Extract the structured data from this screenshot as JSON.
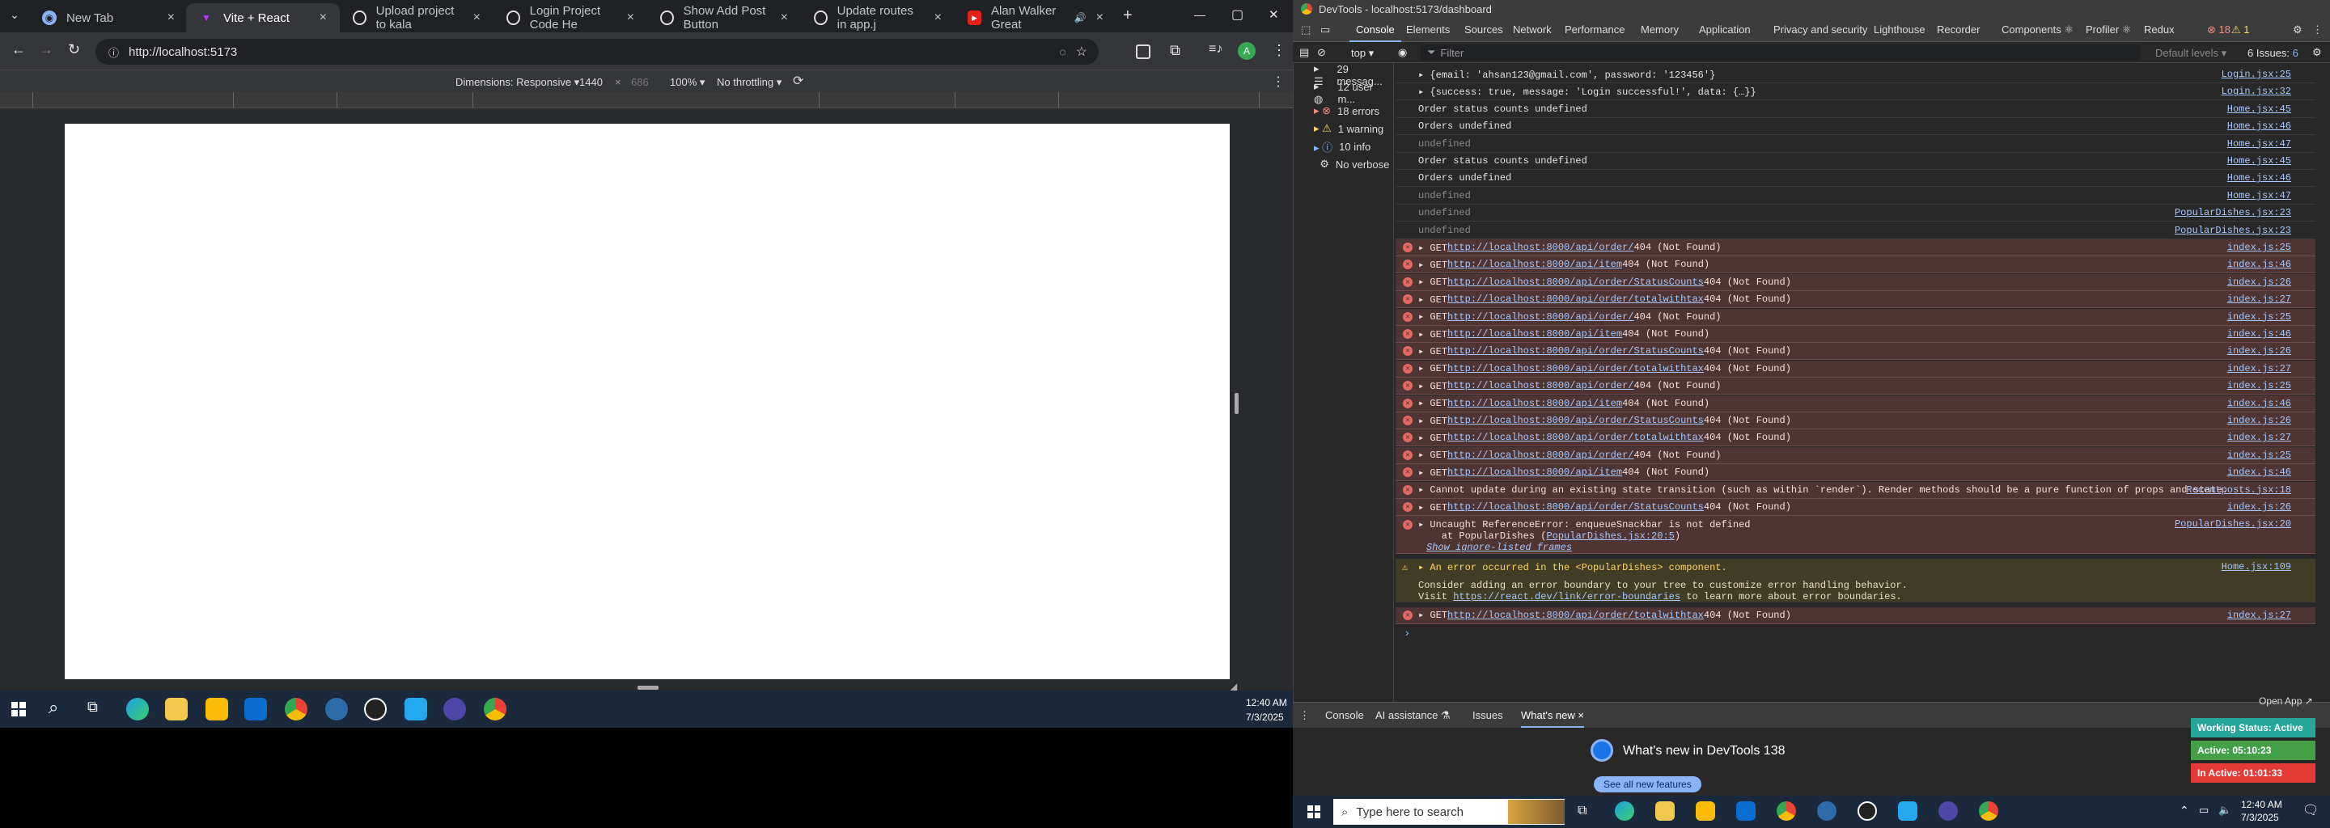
{
  "browser": {
    "tabs": [
      {
        "label": "New Tab",
        "close": "×"
      },
      {
        "label": "Vite + React",
        "close": "×"
      },
      {
        "label": "Upload project to kala",
        "close": "×"
      },
      {
        "label": "Login Project Code He",
        "close": "×"
      },
      {
        "label": "Show Add Post Button",
        "close": "×"
      },
      {
        "label": "Update routes in app.j",
        "close": "×"
      },
      {
        "label": "Alan Walker Great",
        "close": "×"
      }
    ],
    "new_tab": "+",
    "url": "http://localhost:5173",
    "window_controls": {
      "minimize": "—",
      "maximize": "▢",
      "close": "✕"
    }
  },
  "device_toolbar": {
    "dimensions_label": "Dimensions: Responsive ▾",
    "width": "1440",
    "times": "×",
    "height": "686",
    "zoom": "100% ▾",
    "throttling": "No throttling ▾"
  },
  "taskbar_left": {
    "time": "12:40 AM",
    "date": "7/3/2025"
  },
  "devtools": {
    "window_title": "DevTools - localhost:5173/dashboard",
    "tabs": [
      "Console",
      "Elements",
      "Sources",
      "Network",
      "Performance",
      "Memory",
      "Application",
      "Privacy and security",
      "Lighthouse",
      "Recorder",
      "Components ⚛",
      "Profiler ⚛",
      "Redux"
    ],
    "error_count": "18",
    "warning_count": "1",
    "issues_label": "6 Issues:",
    "issues_count": "6",
    "context": "top ▾",
    "filter_placeholder": "Filter",
    "levels": "Default levels ▾",
    "sidebar": [
      {
        "icon": "list",
        "label": "29 messag..."
      },
      {
        "icon": "user",
        "label": "12 user m..."
      },
      {
        "icon": "error",
        "label": "18 errors"
      },
      {
        "icon": "warning",
        "label": "1 warning"
      },
      {
        "icon": "info",
        "label": "10 info"
      },
      {
        "icon": "verbose",
        "label": "No verbose"
      }
    ],
    "console_rows": [
      {
        "type": "log",
        "text": "▸ {email: 'ahsan123@gmail.com', password: '123456'}",
        "src": "Login.jsx:25"
      },
      {
        "type": "log",
        "text": "▸ {success: true, message: 'Login successful!', data: {…}}",
        "src": "Login.jsx:32"
      },
      {
        "type": "log",
        "text": "Order status counts undefined",
        "src": "Home.jsx:45"
      },
      {
        "type": "log",
        "text": "Orders undefined",
        "src": "Home.jsx:46"
      },
      {
        "type": "log",
        "text": "undefined",
        "src": "Home.jsx:47"
      },
      {
        "type": "log",
        "text": "Order status counts undefined",
        "src": "Home.jsx:45"
      },
      {
        "type": "log",
        "text": "Orders undefined",
        "src": "Home.jsx:46"
      },
      {
        "type": "log",
        "text": "undefined",
        "src": "Home.jsx:47"
      },
      {
        "type": "log",
        "text": "undefined",
        "src": "PopularDishes.jsx:23"
      },
      {
        "type": "log",
        "text": "undefined",
        "src": "PopularDishes.jsx:23"
      },
      {
        "type": "err",
        "text": "▸ GET ",
        "url": "http://localhost:8000/api/order/",
        "tail": " 404 (Not Found)",
        "src": "index.js:25"
      },
      {
        "type": "err",
        "text": "▸ GET ",
        "url": "http://localhost:8000/api/item",
        "tail": " 404 (Not Found)",
        "src": "index.js:46"
      },
      {
        "type": "err",
        "text": "▸ GET ",
        "url": "http://localhost:8000/api/order/StatusCounts",
        "tail": " 404 (Not Found)",
        "src": "index.js:26"
      },
      {
        "type": "err",
        "text": "▸ GET ",
        "url": "http://localhost:8000/api/order/totalwithtax",
        "tail": " 404 (Not Found)",
        "src": "index.js:27"
      },
      {
        "type": "err",
        "text": "▸ GET ",
        "url": "http://localhost:8000/api/order/",
        "tail": " 404 (Not Found)",
        "src": "index.js:25"
      },
      {
        "type": "err",
        "text": "▸ GET ",
        "url": "http://localhost:8000/api/item",
        "tail": " 404 (Not Found)",
        "src": "index.js:46"
      },
      {
        "type": "err",
        "text": "▸ GET ",
        "url": "http://localhost:8000/api/order/StatusCounts",
        "tail": " 404 (Not Found)",
        "src": "index.js:26"
      },
      {
        "type": "err",
        "text": "▸ GET ",
        "url": "http://localhost:8000/api/order/totalwithtax",
        "tail": " 404 (Not Found)",
        "src": "index.js:27"
      },
      {
        "type": "err",
        "text": "▸ GET ",
        "url": "http://localhost:8000/api/order/",
        "tail": " 404 (Not Found)",
        "src": "index.js:25"
      },
      {
        "type": "err",
        "text": "▸ GET ",
        "url": "http://localhost:8000/api/item",
        "tail": " 404 (Not Found)",
        "src": "index.js:46"
      },
      {
        "type": "err",
        "text": "▸ GET ",
        "url": "http://localhost:8000/api/order/StatusCounts",
        "tail": " 404 (Not Found)",
        "src": "index.js:26"
      },
      {
        "type": "err",
        "text": "▸ GET ",
        "url": "http://localhost:8000/api/order/totalwithtax",
        "tail": " 404 (Not Found)",
        "src": "index.js:27"
      },
      {
        "type": "err",
        "text": "▸ GET ",
        "url": "http://localhost:8000/api/order/",
        "tail": " 404 (Not Found)",
        "src": "index.js:25"
      },
      {
        "type": "err",
        "text": "▸ GET ",
        "url": "http://localhost:8000/api/item",
        "tail": " 404 (Not Found)",
        "src": "index.js:46"
      },
      {
        "type": "err",
        "text": "▸ Cannot update during an existing state transition (such as within `render`). Render methods should be a pure function of props and state.",
        "src": "Recentposts.jsx:18"
      },
      {
        "type": "err",
        "text": "▸ GET ",
        "url": "http://localhost:8000/api/order/StatusCounts",
        "tail": " 404 (Not Found)",
        "src": "index.js:26"
      }
    ],
    "uncaught": {
      "line1": "▸ Uncaught ReferenceError: enqueueSnackbar is not defined",
      "line2_pre": "    at PopularDishes (",
      "line2_link": "PopularDishes.jsx:20:5",
      "line2_post": ")",
      "line3": "Show ignore-listed frames",
      "src": "PopularDishes.jsx:20"
    },
    "warning": {
      "line1": "▸ An error occurred in the <PopularDishes> component.",
      "line2": "Consider adding an error boundary to your tree to customize error handling behavior.",
      "line3_pre": "Visit ",
      "line3_link": "https://react.dev/link/error-boundaries",
      "line3_post": " to learn more about error boundaries.",
      "src": "Home.jsx:109"
    },
    "last_error": {
      "text": "▸ GET ",
      "url": "http://localhost:8000/api/order/totalwithtax",
      "tail": " 404 (Not Found)",
      "src": "index.js:27"
    },
    "prompt": "›",
    "drawer_tabs": [
      "Console",
      "AI assistance ⚗",
      "Issues",
      "What's new ×"
    ],
    "whats_new_title": "What's new in DevTools 138",
    "see_all": "See all new features"
  },
  "overlay_timer": {
    "open_app": "Open App ↗",
    "status": "Working Status: Active",
    "active": "Active: 05:10:23",
    "inactive": "In Active: 01:01:33",
    "colors": {
      "status": "#26a69a",
      "active": "#43a047",
      "inactive": "#e53935"
    }
  },
  "taskbar_right": {
    "search_placeholder": "Type here to search",
    "time": "12:40 AM",
    "date": "7/3/2025"
  }
}
